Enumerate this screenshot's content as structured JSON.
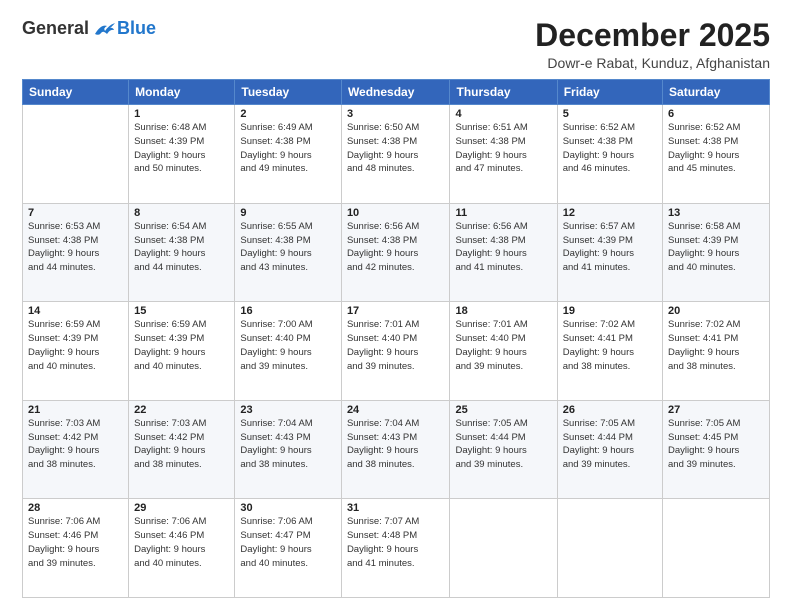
{
  "header": {
    "logo_general": "General",
    "logo_blue": "Blue",
    "title": "December 2025",
    "subtitle": "Dowr-e Rabat, Kunduz, Afghanistan"
  },
  "days_of_week": [
    "Sunday",
    "Monday",
    "Tuesday",
    "Wednesday",
    "Thursday",
    "Friday",
    "Saturday"
  ],
  "weeks": [
    [
      {
        "day": "",
        "info": ""
      },
      {
        "day": "1",
        "info": "Sunrise: 6:48 AM\nSunset: 4:39 PM\nDaylight: 9 hours\nand 50 minutes."
      },
      {
        "day": "2",
        "info": "Sunrise: 6:49 AM\nSunset: 4:38 PM\nDaylight: 9 hours\nand 49 minutes."
      },
      {
        "day": "3",
        "info": "Sunrise: 6:50 AM\nSunset: 4:38 PM\nDaylight: 9 hours\nand 48 minutes."
      },
      {
        "day": "4",
        "info": "Sunrise: 6:51 AM\nSunset: 4:38 PM\nDaylight: 9 hours\nand 47 minutes."
      },
      {
        "day": "5",
        "info": "Sunrise: 6:52 AM\nSunset: 4:38 PM\nDaylight: 9 hours\nand 46 minutes."
      },
      {
        "day": "6",
        "info": "Sunrise: 6:52 AM\nSunset: 4:38 PM\nDaylight: 9 hours\nand 45 minutes."
      }
    ],
    [
      {
        "day": "7",
        "info": "Sunrise: 6:53 AM\nSunset: 4:38 PM\nDaylight: 9 hours\nand 44 minutes."
      },
      {
        "day": "8",
        "info": "Sunrise: 6:54 AM\nSunset: 4:38 PM\nDaylight: 9 hours\nand 44 minutes."
      },
      {
        "day": "9",
        "info": "Sunrise: 6:55 AM\nSunset: 4:38 PM\nDaylight: 9 hours\nand 43 minutes."
      },
      {
        "day": "10",
        "info": "Sunrise: 6:56 AM\nSunset: 4:38 PM\nDaylight: 9 hours\nand 42 minutes."
      },
      {
        "day": "11",
        "info": "Sunrise: 6:56 AM\nSunset: 4:38 PM\nDaylight: 9 hours\nand 41 minutes."
      },
      {
        "day": "12",
        "info": "Sunrise: 6:57 AM\nSunset: 4:39 PM\nDaylight: 9 hours\nand 41 minutes."
      },
      {
        "day": "13",
        "info": "Sunrise: 6:58 AM\nSunset: 4:39 PM\nDaylight: 9 hours\nand 40 minutes."
      }
    ],
    [
      {
        "day": "14",
        "info": "Sunrise: 6:59 AM\nSunset: 4:39 PM\nDaylight: 9 hours\nand 40 minutes."
      },
      {
        "day": "15",
        "info": "Sunrise: 6:59 AM\nSunset: 4:39 PM\nDaylight: 9 hours\nand 40 minutes."
      },
      {
        "day": "16",
        "info": "Sunrise: 7:00 AM\nSunset: 4:40 PM\nDaylight: 9 hours\nand 39 minutes."
      },
      {
        "day": "17",
        "info": "Sunrise: 7:01 AM\nSunset: 4:40 PM\nDaylight: 9 hours\nand 39 minutes."
      },
      {
        "day": "18",
        "info": "Sunrise: 7:01 AM\nSunset: 4:40 PM\nDaylight: 9 hours\nand 39 minutes."
      },
      {
        "day": "19",
        "info": "Sunrise: 7:02 AM\nSunset: 4:41 PM\nDaylight: 9 hours\nand 38 minutes."
      },
      {
        "day": "20",
        "info": "Sunrise: 7:02 AM\nSunset: 4:41 PM\nDaylight: 9 hours\nand 38 minutes."
      }
    ],
    [
      {
        "day": "21",
        "info": "Sunrise: 7:03 AM\nSunset: 4:42 PM\nDaylight: 9 hours\nand 38 minutes."
      },
      {
        "day": "22",
        "info": "Sunrise: 7:03 AM\nSunset: 4:42 PM\nDaylight: 9 hours\nand 38 minutes."
      },
      {
        "day": "23",
        "info": "Sunrise: 7:04 AM\nSunset: 4:43 PM\nDaylight: 9 hours\nand 38 minutes."
      },
      {
        "day": "24",
        "info": "Sunrise: 7:04 AM\nSunset: 4:43 PM\nDaylight: 9 hours\nand 38 minutes."
      },
      {
        "day": "25",
        "info": "Sunrise: 7:05 AM\nSunset: 4:44 PM\nDaylight: 9 hours\nand 39 minutes."
      },
      {
        "day": "26",
        "info": "Sunrise: 7:05 AM\nSunset: 4:44 PM\nDaylight: 9 hours\nand 39 minutes."
      },
      {
        "day": "27",
        "info": "Sunrise: 7:05 AM\nSunset: 4:45 PM\nDaylight: 9 hours\nand 39 minutes."
      }
    ],
    [
      {
        "day": "28",
        "info": "Sunrise: 7:06 AM\nSunset: 4:46 PM\nDaylight: 9 hours\nand 39 minutes."
      },
      {
        "day": "29",
        "info": "Sunrise: 7:06 AM\nSunset: 4:46 PM\nDaylight: 9 hours\nand 40 minutes."
      },
      {
        "day": "30",
        "info": "Sunrise: 7:06 AM\nSunset: 4:47 PM\nDaylight: 9 hours\nand 40 minutes."
      },
      {
        "day": "31",
        "info": "Sunrise: 7:07 AM\nSunset: 4:48 PM\nDaylight: 9 hours\nand 41 minutes."
      },
      {
        "day": "",
        "info": ""
      },
      {
        "day": "",
        "info": ""
      },
      {
        "day": "",
        "info": ""
      }
    ]
  ]
}
